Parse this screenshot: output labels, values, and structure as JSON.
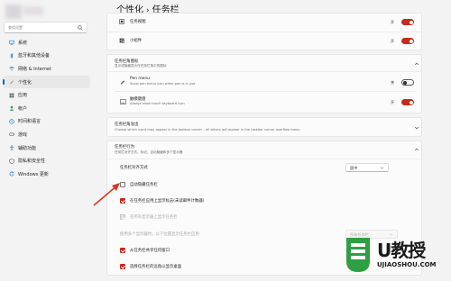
{
  "sidebar": {
    "search_placeholder": "查找设置",
    "items": [
      {
        "label": "系统",
        "icon": "monitor-icon",
        "color": "#0078d4"
      },
      {
        "label": "蓝牙和其他设备",
        "icon": "bluetooth-icon",
        "color": "#0078d4"
      },
      {
        "label": "网络 & Internet",
        "icon": "wifi-icon",
        "color": "#0067c0"
      },
      {
        "label": "个性化",
        "icon": "brush-icon",
        "color": "#c87a2d",
        "active": true
      },
      {
        "label": "应用",
        "icon": "apps-icon",
        "color": "#5b5b5b"
      },
      {
        "label": "帐户",
        "icon": "account-icon",
        "color": "#2e9b5e"
      },
      {
        "label": "时间和语言",
        "icon": "clock-icon",
        "color": "#1f7ad6"
      },
      {
        "label": "游戏",
        "icon": "gamepad-icon",
        "color": "#5b5b5b"
      },
      {
        "label": "辅助功能",
        "icon": "accessibility-icon",
        "color": "#1f7ad6"
      },
      {
        "label": "隐私和安全性",
        "icon": "shield-icon",
        "color": "#5b5b5b"
      },
      {
        "label": "Windows 更新",
        "icon": "update-icon",
        "color": "#0078d4"
      }
    ]
  },
  "header": {
    "crumb1": "个性化",
    "sep": "›",
    "crumb2": "任务栏"
  },
  "taskbar_items": {
    "task_view": {
      "label": "任务视图",
      "state": "开"
    },
    "widgets": {
      "label": "小组件",
      "state": "开"
    }
  },
  "corner_icons": {
    "title": "任务栏角图标",
    "subtitle": "显示或隐藏显示在任务栏角中的图标",
    "pen_menu": {
      "label": "Pen menu",
      "desc": "Show pen menu icon when pen is in use",
      "state": "关"
    },
    "touch_keyboard": {
      "label": "触摸键盘",
      "desc": "Always show touch keyboard icon",
      "state": "开"
    }
  },
  "overflow": {
    "title": "任务栏角溢出",
    "subtitle": "Choose which icons may appear in the taskbar corner – all others will appear in the taskbar corner overflow menu"
  },
  "behaviors": {
    "title": "任务栏行为",
    "subtitle": "任务栏对齐方式、标记、自动隐藏和多个显示器",
    "alignment_label": "任务栏对齐方式",
    "alignment_value": "居中",
    "auto_hide": "自动隐藏任务栏",
    "badges": "在任务栏应用上显示标志(未读邮件计数器)",
    "all_displays": "在所有显示器上显示任务栏",
    "multi_display_label": "使用多个显示器时，以下位置显示任务栏应用",
    "multi_display_value": "所有任务栏",
    "share_window": "从任务栏共享任何窗口",
    "far_corner": "选择任务栏的远角以显示桌面"
  },
  "watermark": {
    "brand": "U教授",
    "url": "UJIAOSHOU.COM"
  },
  "colors": {
    "accent": "#c42b1c",
    "nav_accent": "#0067c0"
  }
}
